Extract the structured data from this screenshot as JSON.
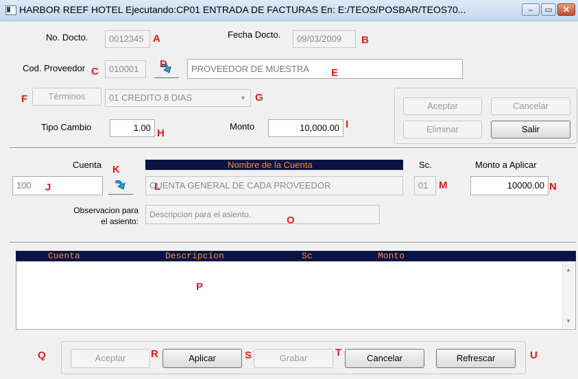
{
  "window": {
    "title": "HARBOR REEF HOTEL Ejecutando:CP01 ENTRADA DE FACTURAS En: E:/TEOS/POSBAR/TEOS70...",
    "minimize": "–",
    "maximize": "▭",
    "close": "✕"
  },
  "header": {
    "doc_no_label": "No. Docto.",
    "doc_no_value": "0012345",
    "doc_date_label": "Fecha Docto.",
    "doc_date_value": "09/03/2009",
    "supplier_label": "Cod. Proveedor",
    "supplier_code": "010001",
    "supplier_name": "PROVEEDOR DE MUESTRA",
    "terms_button": "Términos",
    "terms_value": "01  CREDITO 8 DIAS",
    "exchange_label": "Tipo Cambio",
    "exchange_value": "1.00",
    "amount_label": "Monto",
    "amount_value": "10,000.00"
  },
  "header_buttons": {
    "accept": "Aceptar",
    "cancel": "Cancelar",
    "delete": "Eliminar",
    "exit": "Salir"
  },
  "entry": {
    "account_label": "Cuenta",
    "account_name_header": "Nombre de la Cuenta",
    "sc_label": "Sc.",
    "apply_amount_label": "Monto a Aplicar",
    "account_value": "100",
    "account_name_value": "CUENTA GENERAL DE CADA PROVEEDOR",
    "sc_value": "01",
    "apply_amount_value": "10000.00",
    "observation_label_1": "Observacion para",
    "observation_label_2": "el asiento:",
    "observation_placeholder": "Descripcion para el asiento."
  },
  "grid": {
    "columns": [
      "Cuenta",
      "Descripcion",
      "Sc",
      "Monto"
    ]
  },
  "footer_buttons": {
    "accept": "Aceptar",
    "apply": "Aplicar",
    "save": "Grabar",
    "cancel": "Cancelar",
    "refresh": "Refrescar"
  },
  "markers": {
    "A": "A",
    "B": "B",
    "C": "C",
    "D": "D",
    "E": "E",
    "F": "F",
    "G": "G",
    "H": "H",
    "I": "I",
    "J": "J",
    "K": "K",
    "L": "L",
    "M": "M",
    "N": "N",
    "O": "O",
    "P": "P",
    "Q": "Q",
    "R": "R",
    "S": "S",
    "T": "T",
    "U": "U"
  },
  "colors": {
    "marker": "#e01b1b",
    "grid_header_bg": "#0a1445",
    "grid_header_text": "#ff8a2c"
  },
  "icons": {
    "lookup": "arrow-down-lookup-icon",
    "app": "window-app-icon",
    "dropdown": "chevron-down-icon"
  }
}
